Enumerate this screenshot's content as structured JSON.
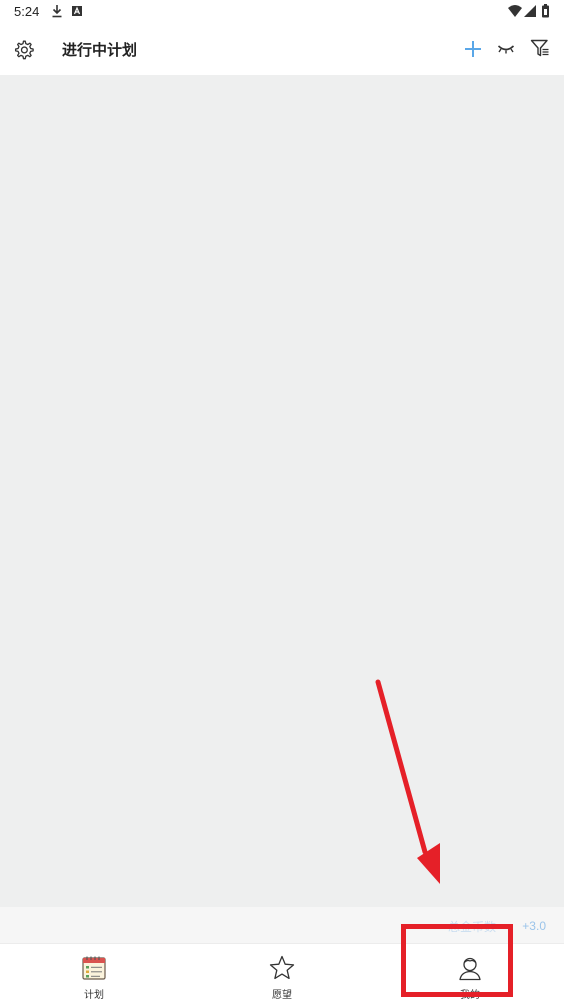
{
  "status_bar": {
    "time": "5:24",
    "left_icons": [
      "download-icon",
      "a-badge-icon"
    ],
    "right_icons": [
      "wifi-icon",
      "signal-icon",
      "battery-icon"
    ]
  },
  "header": {
    "title": "进行中计划",
    "left_icon": "gear-icon",
    "actions": [
      "plus-icon",
      "eye-closed-icon",
      "filter-list-icon"
    ],
    "accent_color": "#5aa7e8"
  },
  "content": {
    "background": "#eeefef"
  },
  "score_bar": {
    "label": "总金币数",
    "value": "+3.0"
  },
  "tabs": [
    {
      "label": "计划",
      "icon": "calendar-plan-icon"
    },
    {
      "label": "愿望",
      "icon": "star-icon"
    },
    {
      "label": "我的",
      "icon": "person-icon"
    }
  ],
  "annotation": {
    "color": "#e52028",
    "target": "我的"
  }
}
